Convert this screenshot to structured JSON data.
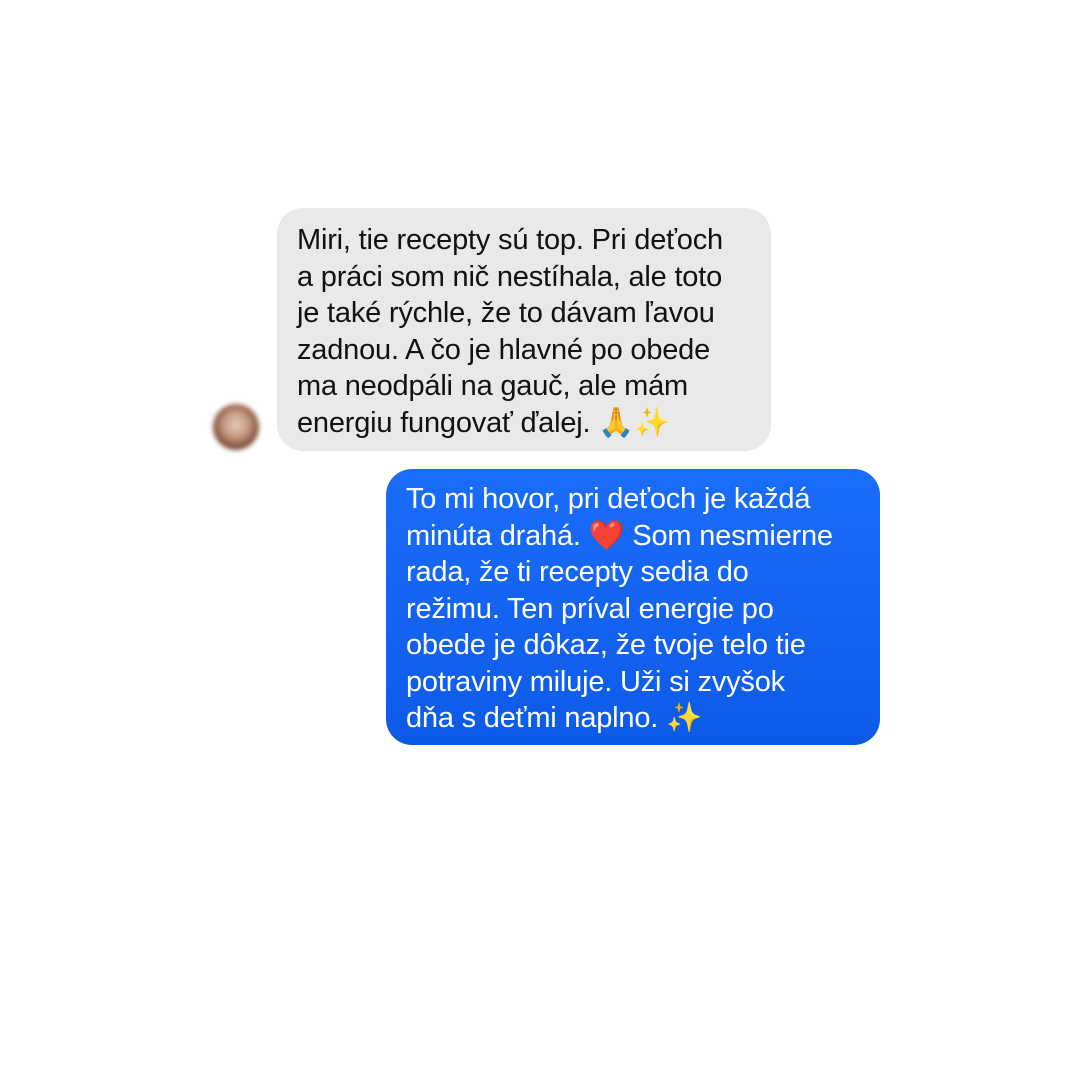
{
  "conversation": {
    "messages": [
      {
        "direction": "incoming",
        "text": "Miri, tie recepty sú top. Pri deťoch\na práci som nič nestíhala, ale toto\nje také rýchle, že to dávam ľavou\nzadnou. A čo je hlavné po obede\nma neodpáli na gauč, ale mám\nenergiu fungovať ďalej. 🙏✨"
      },
      {
        "direction": "outgoing",
        "text": "To mi hovor, pri deťoch je každá\nminúta drahá. ❤️ Som nesmierne\nrada, že ti recepty sedia do\nrežimu. Ten príval energie po\nobede je dôkaz, že tvoje telo tie\npotraviny miluje. Uži si zvyšok\ndňa s deťmi naplno. ✨"
      }
    ]
  },
  "colors": {
    "incoming_bubble": "#e9e9eb",
    "outgoing_bubble": "#1a6dfa",
    "incoming_text": "#111111",
    "outgoing_text": "#ffffff"
  },
  "icons": {
    "avatar": "sender-avatar-photo"
  }
}
